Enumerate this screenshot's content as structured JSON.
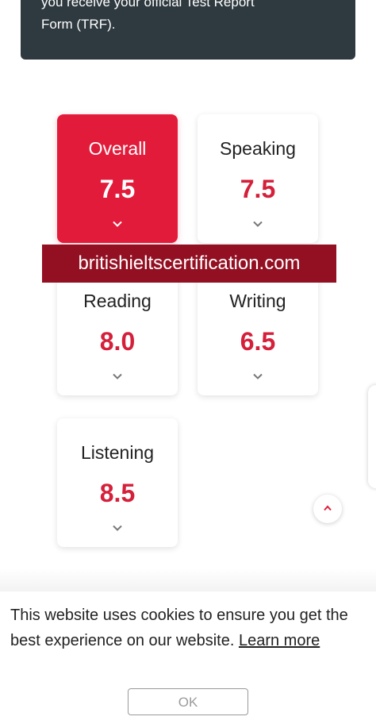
{
  "notice": {
    "line1": "you receive your official Test Report",
    "line2": "Form (TRF)."
  },
  "scores": [
    {
      "label": "Overall",
      "value": "7.5",
      "active": true
    },
    {
      "label": "Speaking",
      "value": "7.5",
      "active": false
    },
    {
      "label": "Reading",
      "value": "8.0",
      "active": false
    },
    {
      "label": "Writing",
      "value": "6.5",
      "active": false
    },
    {
      "label": "Listening",
      "value": "8.5",
      "active": false
    }
  ],
  "watermark": "britishieltscertification.com",
  "cookie": {
    "text": "This website uses cookies to ensure you get the best experience on our website.",
    "learn_more": "Learn more",
    "ok_label": "OK"
  },
  "colors": {
    "accent": "#e31b3a",
    "score_text": "#d4203a",
    "notice_bg": "#2f3a40",
    "watermark_bg": "#930f22"
  }
}
